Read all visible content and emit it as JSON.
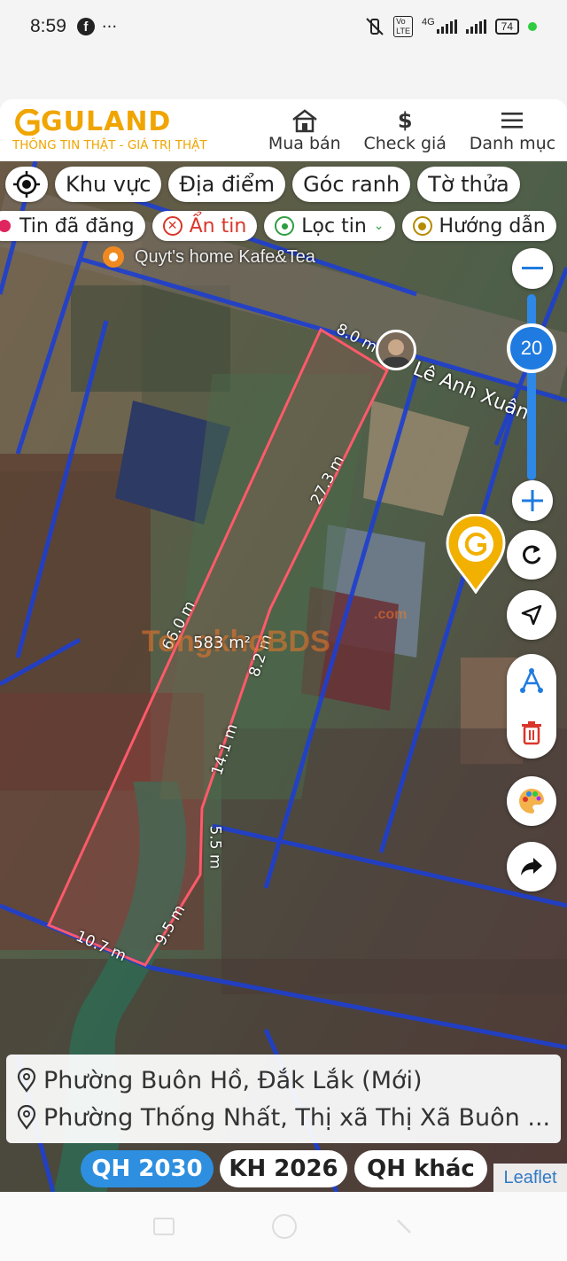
{
  "status_bar": {
    "time": "8:59",
    "more": "···",
    "network": "4G",
    "battery": "74"
  },
  "header": {
    "logo": "GULAND",
    "tagline": "THÔNG TIN THẬT - GIÁ TRỊ THẬT",
    "nav": [
      {
        "label": "Mua bán",
        "icon": "house-icon"
      },
      {
        "label": "Check giá",
        "icon": "dollar-icon"
      },
      {
        "label": "Danh mục",
        "icon": "menu-icon"
      }
    ]
  },
  "filters_row1": [
    "Khu vực",
    "Địa điểm",
    "Góc ranh",
    "Tờ thửa"
  ],
  "filters_row2": [
    "Tin đã đăng",
    "Ẩn tin",
    "Lọc tin",
    "Hướng dẫn"
  ],
  "map": {
    "poi": "Quyt's home Kafe&Tea",
    "street": "Lê Anh Xuân",
    "area": "583 m²",
    "watermark": "TongkhoBDS",
    "watermark_suffix": ".com",
    "edges": [
      "8.0 m",
      "27.3 m",
      "66.0 m",
      "8.2 m",
      "14.1 m",
      "5.5 m",
      "9.5 m",
      "10.7 m"
    ],
    "zoom": "20"
  },
  "address": [
    "Phường Buôn Hồ, Đắk Lắk (Mới)",
    "Phường Thống Nhất, Thị xã Thị Xã Buôn ..."
  ],
  "plan_tabs": [
    "QH 2030",
    "KH 2026",
    "QH khác"
  ],
  "attribution": "Leaflet",
  "colors": {
    "brand": "#f0a500",
    "accent": "#1f7be0",
    "boundary": "#ff5a6a",
    "parcel_lines": "#1e3fd0"
  }
}
